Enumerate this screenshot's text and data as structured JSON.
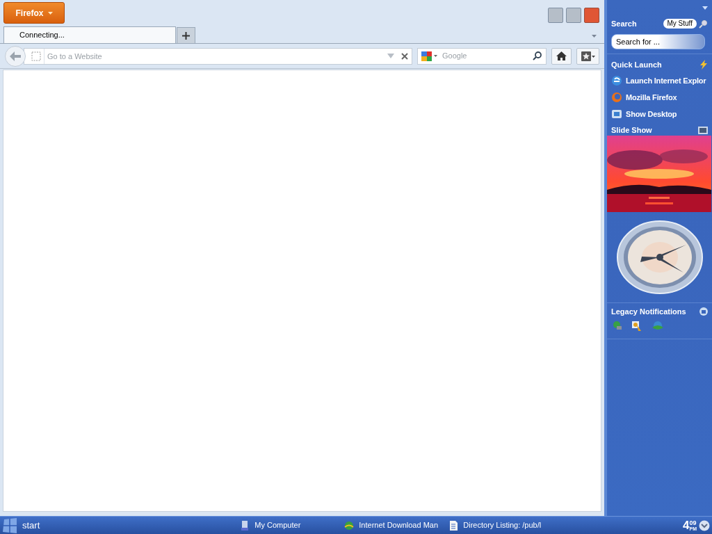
{
  "browser": {
    "menu_button": "Firefox",
    "tabs": [
      {
        "label": "Connecting...",
        "selected": true
      }
    ],
    "url_placeholder": "Go to a Website",
    "search_placeholder": "Google"
  },
  "sidebar": {
    "search": {
      "title": "Search",
      "button": "My Stuff",
      "placeholder": "Search for ..."
    },
    "quick_launch": {
      "title": "Quick Launch",
      "items": [
        {
          "kind": "ie",
          "label": "Launch Internet Explor"
        },
        {
          "kind": "firefox",
          "label": "Mozilla Firefox"
        },
        {
          "kind": "desktop",
          "label": "Show Desktop"
        }
      ]
    },
    "slide_show": {
      "title": "Slide Show"
    },
    "legacy_notifications": {
      "title": "Legacy Notifications"
    }
  },
  "taskbar": {
    "start": "start",
    "items": [
      {
        "kind": "computer",
        "label": "My Computer"
      },
      {
        "kind": "download",
        "label": "Internet Download Man"
      },
      {
        "kind": "document",
        "label": "Directory Listing: /pub/l"
      }
    ],
    "clock": {
      "hour": "4",
      "minutes": "09",
      "period": "PM"
    }
  }
}
